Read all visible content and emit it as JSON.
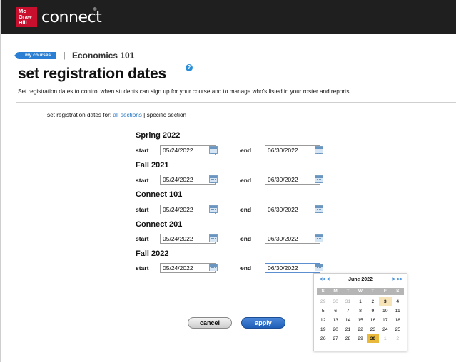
{
  "header": {
    "logo_lines": [
      "Mc",
      "Graw",
      "Hill"
    ],
    "brand": "connect",
    "brand_mark": "®"
  },
  "breadcrumb": {
    "back_label": "my courses",
    "separator": "|",
    "course": "Economics 101"
  },
  "page": {
    "title": "set registration dates",
    "help": "?",
    "description": "Set registration dates to control when students can sign up for your course and to manage who's listed in your roster and reports.",
    "for_label": "set registration dates for: ",
    "all_sections": "all sections",
    "for_separator": " | ",
    "specific_section": "specific section"
  },
  "sections": [
    {
      "title": "Spring 2022",
      "start_label": "start",
      "start": "05/24/2022",
      "end_label": "end",
      "end": "06/30/2022"
    },
    {
      "title": "Fall 2021",
      "start_label": "start",
      "start": "05/24/2022",
      "end_label": "end",
      "end": "06/30/2022"
    },
    {
      "title": "Connect 101",
      "start_label": "start",
      "start": "05/24/2022",
      "end_label": "end",
      "end": "06/30/2022"
    },
    {
      "title": "Connect 201",
      "start_label": "start",
      "start": "05/24/2022",
      "end_label": "end",
      "end": "06/30/2022"
    },
    {
      "title": "Fall 2022",
      "start_label": "start",
      "start": "05/24/2022",
      "end_label": "end",
      "end": "06/30/2022"
    }
  ],
  "buttons": {
    "cancel": "cancel",
    "apply": "apply"
  },
  "calendar": {
    "prev": "<< <",
    "month": "June 2022",
    "next": "> >>",
    "dow": [
      "S",
      "M",
      "T",
      "W",
      "T",
      "F",
      "S"
    ],
    "weeks": [
      [
        "29",
        "30",
        "31",
        "1",
        "2",
        "3",
        "4"
      ],
      [
        "5",
        "6",
        "7",
        "8",
        "9",
        "10",
        "11"
      ],
      [
        "12",
        "13",
        "14",
        "15",
        "16",
        "17",
        "18"
      ],
      [
        "19",
        "20",
        "21",
        "22",
        "23",
        "24",
        "25"
      ],
      [
        "26",
        "27",
        "28",
        "29",
        "30",
        "1",
        "2"
      ]
    ],
    "today": "3",
    "selected": "30",
    "colors": {
      "today": "#f6e4b8",
      "selected": "#e9b93c"
    }
  }
}
